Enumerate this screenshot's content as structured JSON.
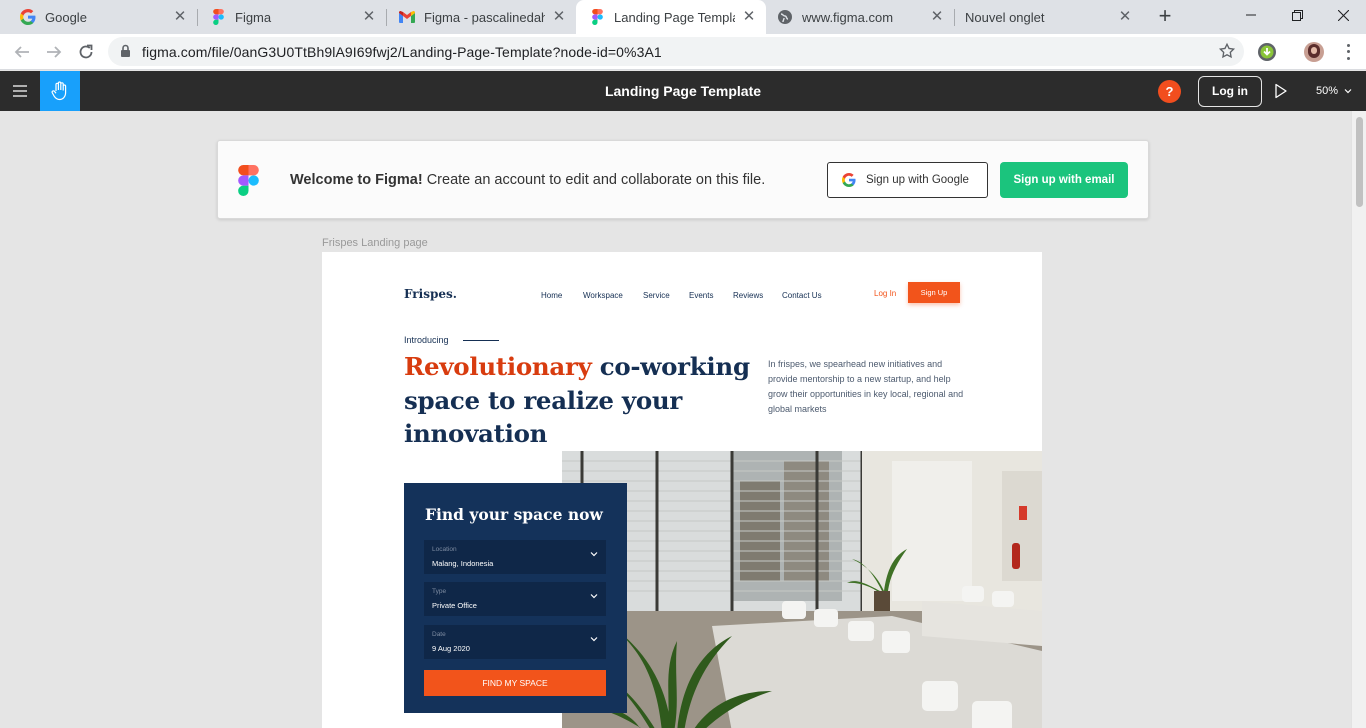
{
  "browser": {
    "tabs": [
      {
        "title": "Google",
        "icon": "google-icon"
      },
      {
        "title": "Figma",
        "icon": "figma-icon"
      },
      {
        "title": "Figma - pascalinedahzin",
        "icon": "gmail-icon"
      },
      {
        "title": "Landing Page Template",
        "icon": "figma-icon",
        "active": true
      },
      {
        "title": "www.figma.com",
        "icon": "globe-icon"
      },
      {
        "title": "Nouvel onglet",
        "icon": "none"
      }
    ],
    "url": "figma.com/file/0anG3U0TtBh9lA9I69fwj2/Landing-Page-Template?node-id=0%3A1"
  },
  "figma": {
    "file_title": "Landing Page Template",
    "help_label": "?",
    "login_label": "Log in",
    "zoom": "50%",
    "accent_color": "#18a0fb"
  },
  "welcome": {
    "bold": "Welcome to Figma!",
    "text": " Create an account to edit and collaborate on this file.",
    "google_button": "Sign up with Google",
    "email_button": "Sign up with email"
  },
  "frame_label": "Frispes Landing page",
  "landing": {
    "brand": "Frispes.",
    "nav": [
      "Home",
      "Workspace",
      "Service",
      "Events",
      "Reviews",
      "Contact Us"
    ],
    "login": "Log In",
    "signup": "Sign Up",
    "intro": "Introducing",
    "headline_accent": "Revolutionary",
    "headline_rest": " co-working space to realize your innovation",
    "description": "In frispes, we spearhead new initiatives and provide mentorship to a new startup, and help grow their opportunities in key local, regional and global markets",
    "finder": {
      "title": "Find your space now",
      "fields": [
        {
          "label": "Location",
          "value": "Malang, Indonesia"
        },
        {
          "label": "Type",
          "value": "Private Office"
        },
        {
          "label": "Date",
          "value": "9 Aug 2020"
        }
      ],
      "button": "FIND MY SPACE"
    },
    "colors": {
      "navy": "#152f53",
      "orange": "#f2541b",
      "accent_text": "#d83c0f"
    }
  }
}
